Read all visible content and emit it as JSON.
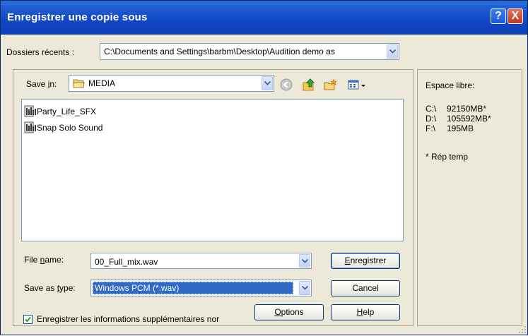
{
  "window": {
    "title": "Enregistrer une copie sous",
    "help_glyph": "?",
    "close_glyph": "X"
  },
  "recent": {
    "label": "Dossiers récents :",
    "value": "C:\\Documents and Settings\\barbm\\Desktop\\Audition demo as"
  },
  "save_in": {
    "label_prefix": "Save ",
    "label_underlined": "i",
    "label_suffix": "n:",
    "folder": "MEDIA"
  },
  "files": [
    {
      "name": "Party_Life_SFX"
    },
    {
      "name": "Snap Solo Sound"
    }
  ],
  "filename": {
    "label_prefix": "File ",
    "label_underlined": "n",
    "label_suffix": "ame:",
    "value": "00_Full_mix.wav"
  },
  "savetype": {
    "label_prefix": "Save as ",
    "label_underlined": "t",
    "label_suffix": "ype:",
    "value": "Windows PCM (*.wav)"
  },
  "extra": {
    "checkbox_label": "Enregistrer les informations supplémentaires nor",
    "checked": true
  },
  "buttons": {
    "save_underlined": "E",
    "save_rest": "nregistrer",
    "cancel": "Cancel",
    "options_underlined": "O",
    "options_rest": "ptions",
    "help_underlined": "H",
    "help_rest": "elp"
  },
  "free_space": {
    "title": "Espace libre:",
    "drives": [
      {
        "drive": "C:\\",
        "value": "92150MB*"
      },
      {
        "drive": "D:\\",
        "value": "105592MB*"
      },
      {
        "drive": "F:\\",
        "value": "195MB"
      }
    ],
    "note": "* Rép temp"
  },
  "colors": {
    "titlebar": "#0f3fb7",
    "selection": "#316ac5",
    "dialog_bg": "#ece9d8"
  }
}
